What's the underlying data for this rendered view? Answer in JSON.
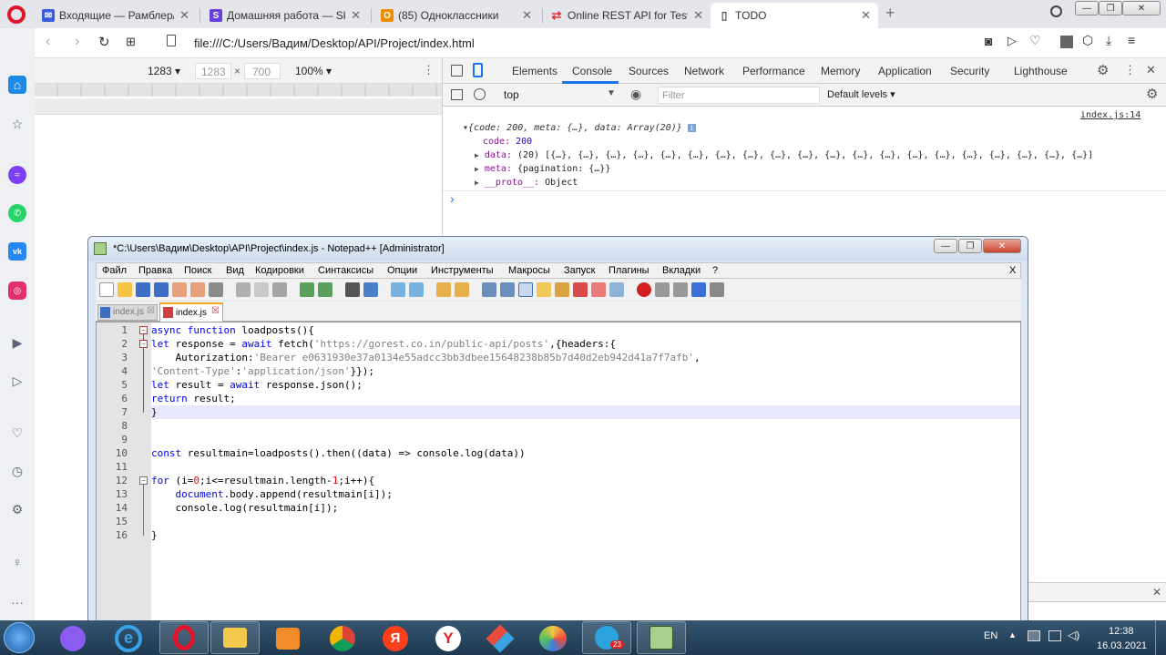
{
  "browser": {
    "tabs": [
      {
        "title": "Входящие — Рамблер/по",
        "color": "#3b5bdb",
        "glyph": "✉"
      },
      {
        "title": "Домашняя работа — Skill",
        "color": "#6741d9",
        "glyph": "S"
      },
      {
        "title": "(85) Одноклассники",
        "color": "#f08c00",
        "glyph": "О"
      },
      {
        "title": "Online REST API for Testing",
        "color": "#e03131",
        "glyph": "⇄"
      },
      {
        "title": "TODO",
        "color": "#868e96",
        "glyph": "▯"
      }
    ],
    "new_tab_glyph": "+",
    "url": "file:///C:/Users/Вадим/Desktop/API/Project/index.html"
  },
  "device_toolbar": {
    "width_select": "1283 ▾",
    "width": "1283",
    "times": "×",
    "height": "700",
    "zoom": "100% ▾"
  },
  "devtools": {
    "tabs": [
      "Elements",
      "Console",
      "Sources",
      "Network",
      "Performance",
      "Memory",
      "Application",
      "Security",
      "Lighthouse"
    ],
    "active_tab": "Console",
    "context": "top",
    "filter_placeholder": "Filter",
    "levels": "Default levels ▾",
    "source_link": "index.js:14",
    "log": {
      "summary": "{code: 200, meta: {…}, data: Array(20)}",
      "code_key": "code:",
      "code_val": "200",
      "data_key": "data:",
      "data_val": "(20) [{…}, {…}, {…}, {…}, {…}, {…}, {…}, {…}, {…}, {…}, {…}, {…}, {…}, {…}, {…}, {…}, {…}, {…}, {…}, {…}]",
      "meta_key": "meta:",
      "meta_val": "{pagination: {…}}",
      "proto_key": "__proto__:",
      "proto_val": "Object"
    },
    "prompt": "›"
  },
  "notepad": {
    "title": "*C:\\Users\\Вадим\\Desktop\\API\\Project\\index.js - Notepad++ [Administrator]",
    "menu": [
      "Файл",
      "Правка",
      "Поиск",
      "Вид",
      "Кодировки",
      "Синтаксисы",
      "Опции",
      "Инструменты",
      "Макросы",
      "Запуск",
      "Плагины",
      "Вкладки",
      "?"
    ],
    "menu_close": "X",
    "tabs": [
      "index.js",
      "index.js"
    ],
    "lines": [
      {
        "n": "1",
        "code": "async function loadposts(){"
      },
      {
        "n": "2",
        "code": "let response = await fetch('https://gorest.co.in/public-api/posts',{headers:{"
      },
      {
        "n": "3",
        "code": "    Autorization:'Bearer e0631930e37a0134e55adcc3bb3dbee15648238b85b7d40d2eb942d41a7f7afb',"
      },
      {
        "n": "4",
        "code": "'Content-Type':'application/json'}});"
      },
      {
        "n": "5",
        "code": "let result = await response.json();"
      },
      {
        "n": "6",
        "code": "return result;"
      },
      {
        "n": "7",
        "code": "}"
      },
      {
        "n": "8",
        "code": ""
      },
      {
        "n": "9",
        "code": ""
      },
      {
        "n": "10",
        "code": "const resultmain=loadposts().then((data) => console.log(data))"
      },
      {
        "n": "11",
        "code": ""
      },
      {
        "n": "12",
        "code": "for (i=0;i<=resultmain.length-1;i++){"
      },
      {
        "n": "13",
        "code": "    document.body.append(resultmain[i]);"
      },
      {
        "n": "14",
        "code": "    console.log(resultmain[i]);"
      },
      {
        "n": "15",
        "code": ""
      },
      {
        "n": "16",
        "code": "}"
      }
    ]
  },
  "taskbar": {
    "lang": "EN",
    "time": "12:38",
    "date": "16.03.2021",
    "badge": "23"
  }
}
